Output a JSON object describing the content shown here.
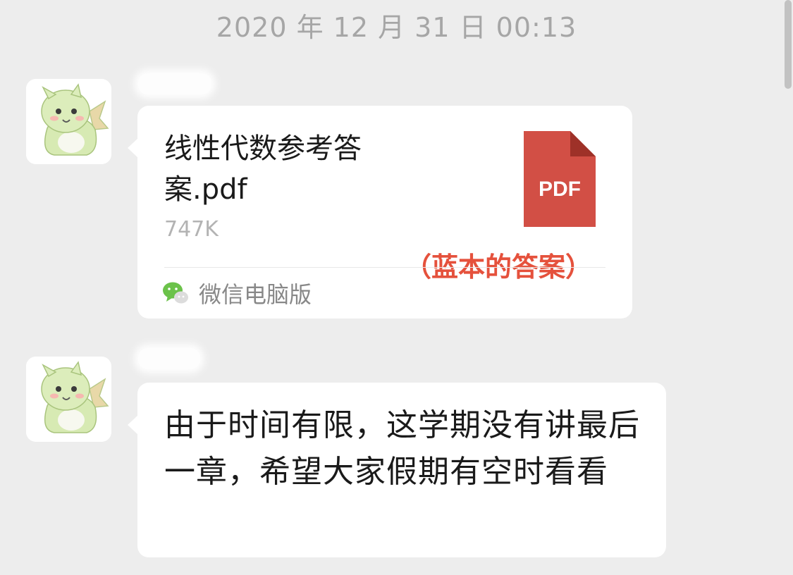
{
  "chat": {
    "timestamp": "2020 年 12 月 31 日  00:13"
  },
  "messages": [
    {
      "type": "file",
      "file_name": "线性代数参考答案.pdf",
      "file_size": "747K",
      "file_icon": "pdf-icon",
      "file_icon_label": "PDF",
      "file_icon_color": "#d24f45",
      "annotation": "（蓝本的答案）",
      "annotation_color": "#e5513c",
      "source_icon": "wechat-icon",
      "source_label": "微信电脑版"
    },
    {
      "type": "text",
      "text": "由于时间有限，这学期没有讲最后一章，希望大家假期有空时看看"
    }
  ]
}
